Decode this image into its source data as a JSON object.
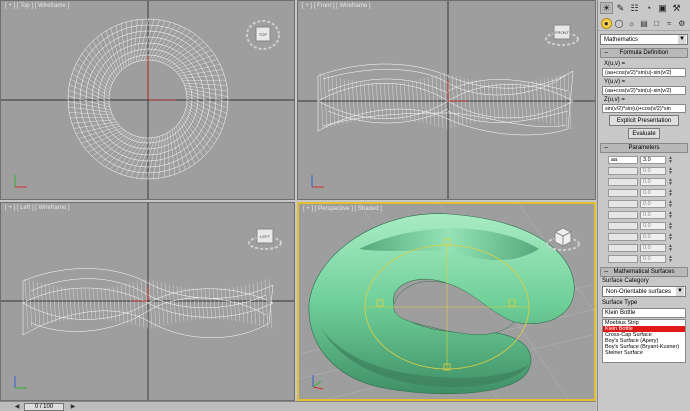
{
  "viewports": {
    "top": {
      "title": "[ + ] [ Top ] [ Wireframe ]"
    },
    "front": {
      "title": "[ + ] [ Front ] [ Wireframe ]"
    },
    "left": {
      "title": "[ + ] [ Left ] [ Wireframe ]"
    },
    "perspective": {
      "title": "[ + ] [ Perspective ] [ Shaded ]"
    }
  },
  "viewcube_labels": {
    "top": "TOP",
    "front": "FRONT",
    "left": "LEFT"
  },
  "timebar": {
    "frame": "0 / 100"
  },
  "panel": {
    "tabs": [
      "create-icon",
      "modify-icon",
      "hierarchy-icon",
      "motion-icon",
      "display-icon",
      "utilities-icon"
    ],
    "category_dropdown": "Mathematics",
    "formula_rollout": "Formula Definition",
    "x_label": "X(u,v) =",
    "x_formula": "(aa+cos(v/2)*sin(u)-sin(v/2)",
    "y_label": "Y(u,v) =",
    "y_formula": "(aa+cos(v/2)*sin(u)-sin(v/2)",
    "z_label": "Z(u,v) =",
    "z_formula": "sin(v/2)*sin(u)+cos(v/2)*sin",
    "explicit_button": "Explicit Presentation",
    "evaluate_button": "Evaluate",
    "parameters_rollout": "Parameters",
    "params": [
      {
        "name": "aa",
        "value": "3.0"
      },
      {
        "name": "",
        "value": "0.0"
      },
      {
        "name": "",
        "value": "0.0"
      },
      {
        "name": "",
        "value": "0.0"
      },
      {
        "name": "",
        "value": "0.0"
      },
      {
        "name": "",
        "value": "0.0"
      },
      {
        "name": "",
        "value": "0.0"
      },
      {
        "name": "",
        "value": "0.0"
      },
      {
        "name": "",
        "value": "0.0"
      },
      {
        "name": "",
        "value": "0.0"
      }
    ],
    "math_rollout": "Mathematical Surfaces",
    "surface_category_label": "Surface Category",
    "surface_category_value": "Non-Orientable surfaces",
    "surface_type_label": "Surface Type",
    "surface_type_value": "Klein Bottle",
    "surface_list": [
      {
        "label": "Moebius Strip",
        "selected": false
      },
      {
        "label": "Klein Bottle",
        "selected": true
      },
      {
        "label": "Cross-Cap Surface",
        "selected": false
      },
      {
        "label": "Boy's Surface (Apery)",
        "selected": false
      },
      {
        "label": "Boy's Surface (Bryant-Kusner)",
        "selected": false
      },
      {
        "label": "Steiner Surface",
        "selected": false
      }
    ]
  },
  "colors": {
    "viewport_bg": "#9e9e9e",
    "active_border": "#e0c030",
    "shaded_surface": "#7fd3a6",
    "selection_red": "#e01818"
  }
}
